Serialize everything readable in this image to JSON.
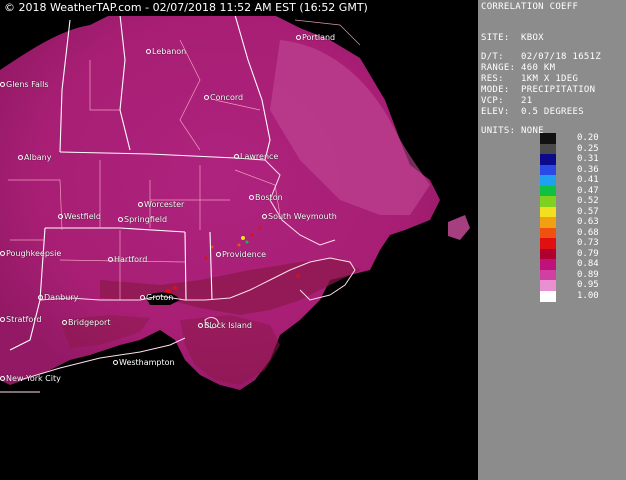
{
  "banner": "© 2018 WeatherTAP.com - 02/07/2018 11:52 AM EST (16:52 GMT)",
  "panel": {
    "product": "CORRELATION COEFF",
    "site_line": "SITE:  KBOX",
    "dt_line": "D/T:   02/07/18 1651Z",
    "range_line": "RANGE: 460 KM",
    "res_line": "RES:   1KM X 1DEG",
    "mode_line": "MODE:  PRECIPITATION",
    "vcp_line": "VCP:   21",
    "elev_line": "ELEV:  0.5 DEGREES",
    "units_line": "UNITS: NONE"
  },
  "scale": {
    "labels": [
      "0.20",
      "0.25",
      "0.31",
      "0.36",
      "0.41",
      "0.47",
      "0.52",
      "0.57",
      "0.63",
      "0.68",
      "0.73",
      "0.79",
      "0.84",
      "0.89",
      "0.95",
      "1.00"
    ],
    "colors": [
      "#111111",
      "#4a4a4a",
      "#0a0a8a",
      "#2a4ae6",
      "#1fa0f0",
      "#10c040",
      "#80d020",
      "#f0e020",
      "#f0a010",
      "#f05010",
      "#e01010",
      "#b00030",
      "#c0107a",
      "#d040a0",
      "#e890d0",
      "#ffffff"
    ]
  },
  "colors": {
    "echo": "#b0207a",
    "echo_light": "#c24a95",
    "echo_dark": "#8a1848",
    "border": "#ffffff",
    "state": "#ffb0c8"
  },
  "map": {
    "cities": [
      {
        "name": "Portland",
        "icon": "city-dot-icon"
      },
      {
        "name": "Lebanon",
        "icon": "city-dot-icon"
      },
      {
        "name": "Glens Falls",
        "icon": "city-dot-icon"
      },
      {
        "name": "Concord",
        "icon": "city-dot-icon"
      },
      {
        "name": "Albany",
        "icon": "city-dot-icon"
      },
      {
        "name": "Lawrence",
        "icon": "city-dot-icon"
      },
      {
        "name": "Boston",
        "icon": "city-dot-icon"
      },
      {
        "name": "Worcester",
        "icon": "city-dot-icon"
      },
      {
        "name": "Westfield",
        "icon": "city-dot-icon"
      },
      {
        "name": "Springfield",
        "icon": "city-dot-icon"
      },
      {
        "name": "South Weymouth",
        "icon": "city-dot-icon"
      },
      {
        "name": "Poughkeepsie",
        "icon": "city-dot-icon"
      },
      {
        "name": "Hartford",
        "icon": "city-dot-icon"
      },
      {
        "name": "Providence",
        "icon": "city-dot-icon"
      },
      {
        "name": "Danbury",
        "icon": "city-dot-icon"
      },
      {
        "name": "Groton",
        "icon": "city-dot-icon"
      },
      {
        "name": "Block Island",
        "icon": "city-dot-icon"
      },
      {
        "name": "Stratford",
        "icon": "city-dot-icon"
      },
      {
        "name": "Bridgeport",
        "icon": "city-dot-icon"
      },
      {
        "name": "Westhampton",
        "icon": "city-dot-icon"
      },
      {
        "name": "New York City",
        "icon": "city-dot-icon"
      }
    ]
  }
}
